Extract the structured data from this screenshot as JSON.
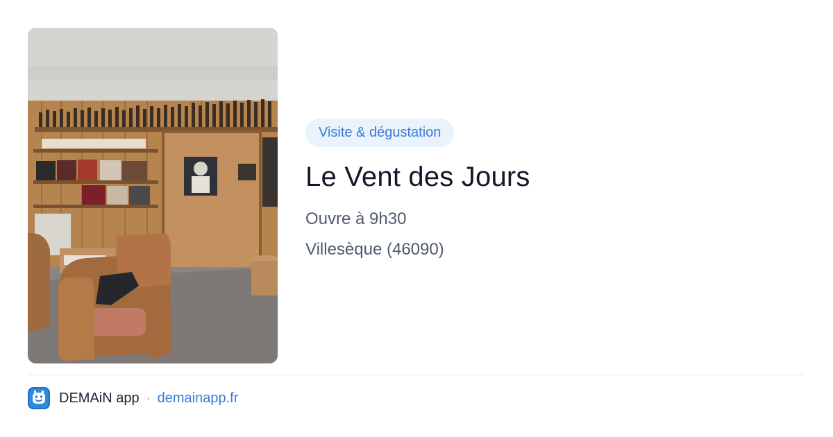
{
  "card": {
    "tag": "Visite & dégustation",
    "title": "Le Vent des Jours",
    "opening": "Ouvre à 9h30",
    "location": "Villesèque (46090)"
  },
  "footer": {
    "brand": "DEMAiN app",
    "separator": "·",
    "site": "demainapp.fr"
  },
  "icons": {
    "app": "demain-app-icon"
  },
  "colors": {
    "accent": "#3a7bd5",
    "tag_bg": "#eaf2fc",
    "app_icon": "#2b8be0"
  }
}
